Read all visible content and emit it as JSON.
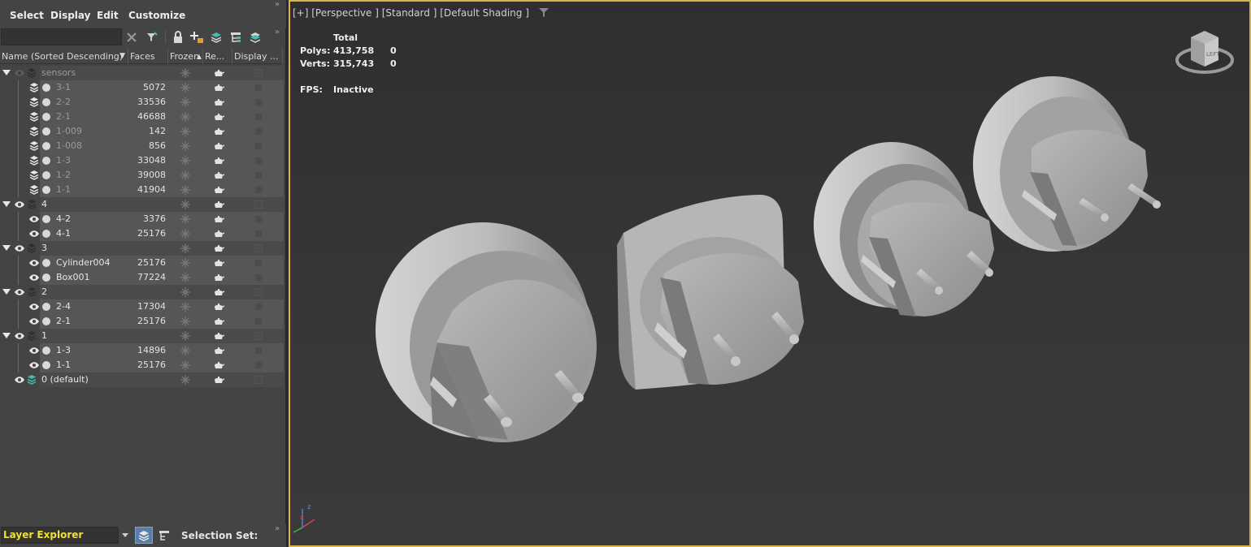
{
  "menu": [
    "Select",
    "Display",
    "Edit",
    "Customize"
  ],
  "toolbar": {
    "search_placeholder": "",
    "icons": [
      "clear-icon",
      "filter-icon",
      "lock-icon",
      "add-to-layer-icon",
      "layers-icon",
      "hierarchy-icon",
      "layer-stack-icon"
    ]
  },
  "columns": {
    "name": "Name (Sorted Descending)",
    "faces": "Faces",
    "frozen": "Frozen",
    "render": "Re...",
    "display": "Display ..."
  },
  "rows": [
    {
      "name": "sensors",
      "faces": "",
      "kind": "layer-hidden",
      "depth": 0
    },
    {
      "name": "3-1",
      "faces": "5072",
      "kind": "obj-hidden",
      "depth": 1
    },
    {
      "name": "2-2",
      "faces": "33536",
      "kind": "obj-hidden",
      "depth": 1
    },
    {
      "name": "2-1",
      "faces": "46688",
      "kind": "obj-hidden",
      "depth": 1
    },
    {
      "name": "1-009",
      "faces": "142",
      "kind": "obj-hidden",
      "depth": 1
    },
    {
      "name": "1-008",
      "faces": "856",
      "kind": "obj-hidden",
      "depth": 1
    },
    {
      "name": "1-3",
      "faces": "33048",
      "kind": "obj-hidden",
      "depth": 1
    },
    {
      "name": "1-2",
      "faces": "39008",
      "kind": "obj-hidden",
      "depth": 1
    },
    {
      "name": "1-1",
      "faces": "41904",
      "kind": "obj-hidden",
      "depth": 1
    },
    {
      "name": "4",
      "faces": "",
      "kind": "layer",
      "depth": 0
    },
    {
      "name": "4-2",
      "faces": "3376",
      "kind": "obj",
      "depth": 1
    },
    {
      "name": "4-1",
      "faces": "25176",
      "kind": "obj",
      "depth": 1
    },
    {
      "name": "3",
      "faces": "",
      "kind": "layer",
      "depth": 0
    },
    {
      "name": "Cylinder004",
      "faces": "25176",
      "kind": "obj",
      "depth": 1
    },
    {
      "name": "Box001",
      "faces": "77224",
      "kind": "obj",
      "depth": 1
    },
    {
      "name": "2",
      "faces": "",
      "kind": "layer",
      "depth": 0
    },
    {
      "name": "2-4",
      "faces": "17304",
      "kind": "obj",
      "depth": 1
    },
    {
      "name": "2-1",
      "faces": "25176",
      "kind": "obj",
      "depth": 1
    },
    {
      "name": "1",
      "faces": "",
      "kind": "layer",
      "depth": 0
    },
    {
      "name": "1-3",
      "faces": "14896",
      "kind": "obj",
      "depth": 1
    },
    {
      "name": "1-1",
      "faces": "25176",
      "kind": "obj",
      "depth": 1
    },
    {
      "name": "0 (default)",
      "faces": "",
      "kind": "layer-default",
      "depth": 0
    }
  ],
  "bottombar": {
    "explorer_name": "Layer Explorer",
    "selection_set_label": "Selection Set:"
  },
  "viewport": {
    "label": "[+] [Perspective ] [Standard ] [Default Shading ]",
    "stats": {
      "total_label": "Total",
      "polys_label": "Polys:",
      "polys_total": "413,758",
      "polys_sel": "0",
      "verts_label": "Verts:",
      "verts_total": "315,743",
      "verts_sel": "0",
      "fps_label": "FPS:",
      "fps_value": "Inactive"
    },
    "viewcube_label": "LEFT",
    "axis_labels": {
      "x": "x",
      "z": "z"
    }
  },
  "colors": {
    "accent_border": "#d9b44a",
    "explorer_name": "#f0e030",
    "layer_teal": "#3fbfb0"
  }
}
